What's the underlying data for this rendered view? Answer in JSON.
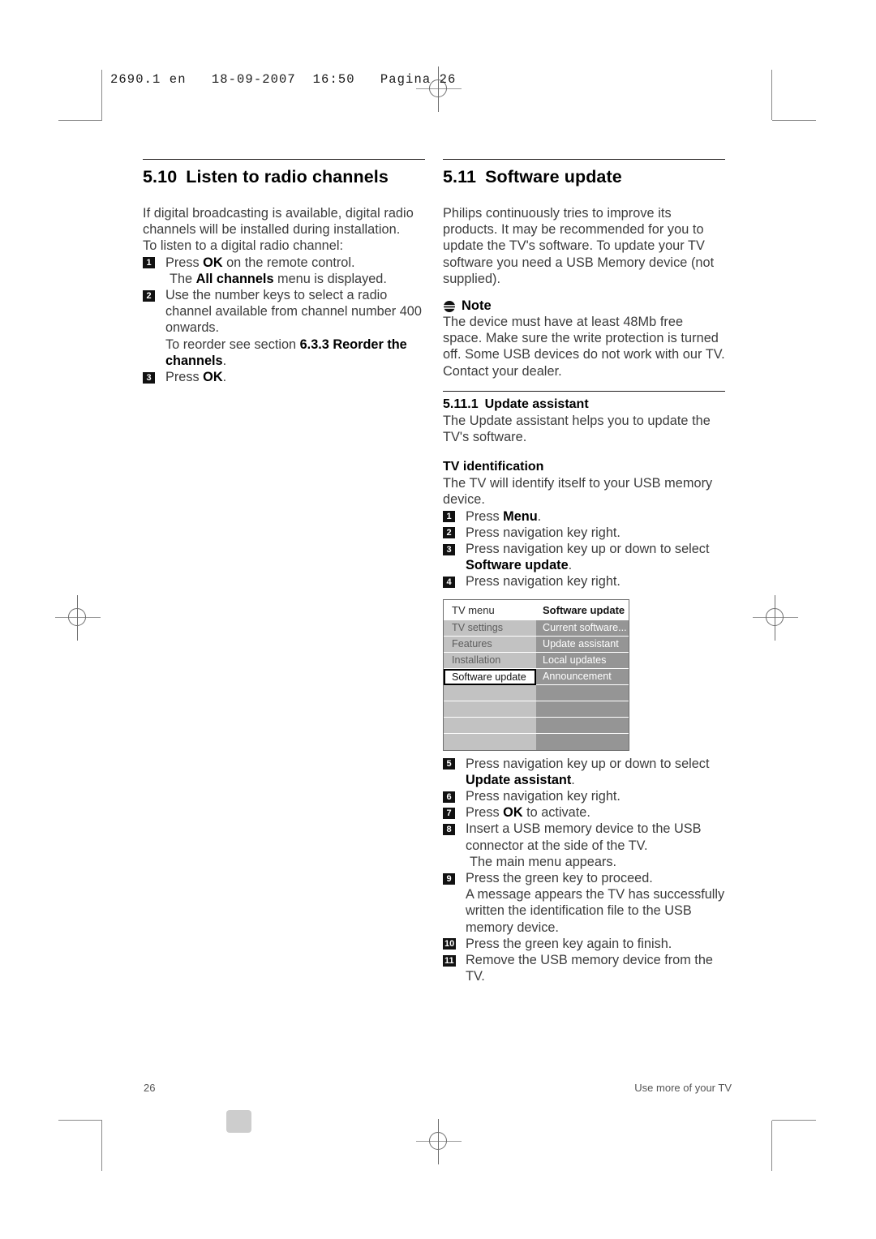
{
  "print_slug": "2690.1 en   18-09-2007  16:50   Pagina 26",
  "left_column": {
    "section_number": "5.10",
    "section_title": "Listen to radio channels",
    "intro": [
      "If digital broadcasting is available, digital radio channels will be installed during installation.",
      "To listen to a digital radio channel:"
    ],
    "steps": [
      {
        "num": "1",
        "parts": [
          {
            "text": "Press "
          },
          {
            "text": "OK",
            "bold": true
          },
          {
            "text": " on the remote control."
          }
        ],
        "sub": [
          {
            "parts": [
              {
                "text": "The "
              },
              {
                "text": "All channels",
                "bold": true
              },
              {
                "text": " menu is displayed."
              }
            ]
          }
        ]
      },
      {
        "num": "2",
        "parts": [
          {
            "text": "Use the number keys to select a radio channel available from channel number 400 onwards."
          }
        ],
        "cont": [
          {
            "parts": [
              {
                "text": "To reorder see section "
              },
              {
                "text": "6.3.3 Reorder the channels",
                "bold": true
              },
              {
                "text": "."
              }
            ]
          }
        ]
      },
      {
        "num": "3",
        "parts": [
          {
            "text": "Press "
          },
          {
            "text": "OK",
            "bold": true
          },
          {
            "text": "."
          }
        ]
      }
    ]
  },
  "right_column": {
    "section_number": "5.11",
    "section_title": "Software update",
    "intro": [
      "Philips continuously tries to improve its products. It may be recommended for you to update the TV's software. To update your TV software you need a USB Memory device (not supplied)."
    ],
    "note": {
      "icon": "note-icon",
      "label": "Note",
      "body": [
        "The device must have at least 48Mb free space. Make sure the write protection is turned off. Some USB devices do not work with our TV. Contact your dealer."
      ]
    },
    "subsection": {
      "number": "5.11.1",
      "title": "Update assistant",
      "body": "The Update assistant helps you to update the TV's software."
    },
    "tv_identification": {
      "title": "TV identification",
      "body": "The TV will identify itself to your USB memory device.",
      "steps_before_figure": [
        {
          "num": "1",
          "parts": [
            {
              "text": "Press "
            },
            {
              "text": "Menu",
              "bold": true
            },
            {
              "text": "."
            }
          ]
        },
        {
          "num": "2",
          "parts": [
            {
              "text": "Press navigation key right."
            }
          ]
        },
        {
          "num": "3",
          "parts": [
            {
              "text": "Press navigation key up or down to select "
            },
            {
              "text": "Software update",
              "bold": true
            },
            {
              "text": "."
            }
          ]
        },
        {
          "num": "4",
          "parts": [
            {
              "text": "Press navigation key right."
            }
          ]
        }
      ],
      "steps_after_figure": [
        {
          "num": "5",
          "parts": [
            {
              "text": "Press navigation key up or down to select "
            },
            {
              "text": "Update assistant",
              "bold": true
            },
            {
              "text": "."
            }
          ]
        },
        {
          "num": "6",
          "parts": [
            {
              "text": "Press navigation key right."
            }
          ]
        },
        {
          "num": "7",
          "parts": [
            {
              "text": "Press "
            },
            {
              "text": "OK",
              "bold": true
            },
            {
              "text": " to activate."
            }
          ]
        },
        {
          "num": "8",
          "parts": [
            {
              "text": "Insert a USB memory device to the USB connector at the side of the TV."
            }
          ],
          "sub": [
            {
              "parts": [
                {
                  "text": "The main menu appears."
                }
              ]
            }
          ]
        },
        {
          "num": "9",
          "parts": [
            {
              "text": " Press the green key to proceed."
            }
          ],
          "cont": [
            {
              "parts": [
                {
                  "text": "A message appears the TV has successfully written the identification file to the USB memory device."
                }
              ]
            }
          ]
        },
        {
          "num": "10",
          "parts": [
            {
              "text": "Press the green key again to finish."
            }
          ]
        },
        {
          "num": "11",
          "parts": [
            {
              "text": "Remove the USB memory device from the TV."
            }
          ]
        }
      ]
    },
    "tv_menu_figure": {
      "header": {
        "left": "TV menu",
        "right": "Software update"
      },
      "left_items": [
        "TV settings",
        "Features",
        "Installation",
        "Software update",
        "",
        "",
        "",
        ""
      ],
      "right_items": [
        "Current software...",
        "Update assistant",
        "Local updates",
        "Announcement",
        "",
        "",
        "",
        ""
      ],
      "selected_left_index": 3,
      "colors": {
        "left_panel": "#c2c2c2",
        "right_panel": "#959595",
        "selection_border": "#000000",
        "border": "#6d6d6d"
      }
    }
  },
  "footer": {
    "page_number": "26",
    "section_label": "Use more of your TV"
  }
}
